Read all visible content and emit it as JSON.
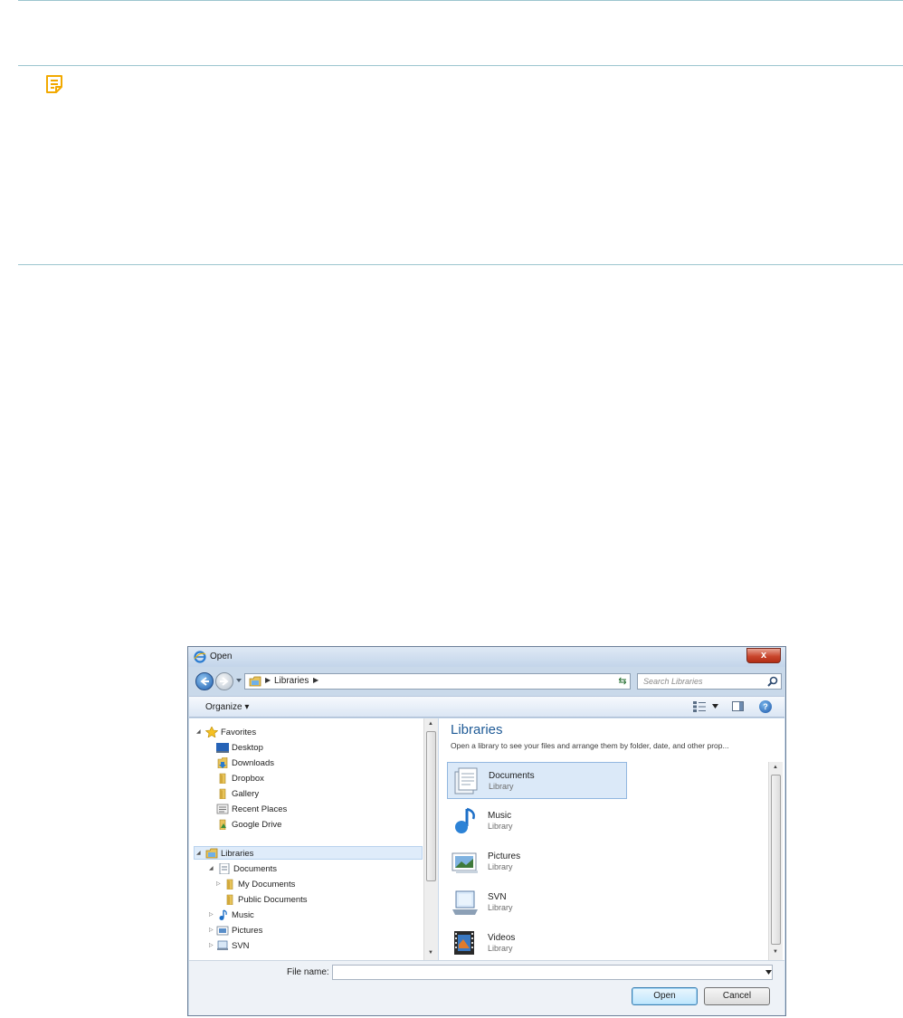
{
  "page": {
    "note_icon": "note-icon"
  },
  "dialog": {
    "title": "Open",
    "close_label": "x",
    "address": {
      "path": "Libraries"
    },
    "search": {
      "placeholder": "Search Libraries"
    },
    "toolbar": {
      "organize_label": "Organize ▾"
    },
    "nav_tree": {
      "items": [
        {
          "label": "Favorites",
          "icon": "star-icon"
        },
        {
          "label": "Desktop",
          "icon": "desktop-icon"
        },
        {
          "label": "Downloads",
          "icon": "downloads-folder-icon"
        },
        {
          "label": "Dropbox",
          "icon": "folder-icon"
        },
        {
          "label": "Gallery",
          "icon": "folder-icon"
        },
        {
          "label": "Recent Places",
          "icon": "recent-places-icon"
        },
        {
          "label": "Google Drive",
          "icon": "google-drive-icon"
        },
        {
          "label": "Libraries",
          "icon": "libraries-icon"
        },
        {
          "label": "Documents",
          "icon": "documents-library-icon"
        },
        {
          "label": "My Documents",
          "icon": "folder-icon"
        },
        {
          "label": "Public Documents",
          "icon": "folder-icon"
        },
        {
          "label": "Music",
          "icon": "music-icon"
        },
        {
          "label": "Pictures",
          "icon": "pictures-icon"
        },
        {
          "label": "SVN",
          "icon": "svn-icon"
        }
      ]
    },
    "content": {
      "heading": "Libraries",
      "subheading": "Open a library to see your files and arrange them by folder, date, and other prop...",
      "libraries": [
        {
          "name": "Documents",
          "type": "Library",
          "icon": "documents-library-icon"
        },
        {
          "name": "Music",
          "type": "Library",
          "icon": "music-library-icon"
        },
        {
          "name": "Pictures",
          "type": "Library",
          "icon": "pictures-library-icon"
        },
        {
          "name": "SVN",
          "type": "Library",
          "icon": "svn-library-icon"
        },
        {
          "name": "Videos",
          "type": "Library",
          "icon": "videos-library-icon"
        }
      ]
    },
    "bottom": {
      "file_name_label": "File name:",
      "file_name_value": "",
      "open_label": "Open",
      "cancel_label": "Cancel"
    }
  }
}
